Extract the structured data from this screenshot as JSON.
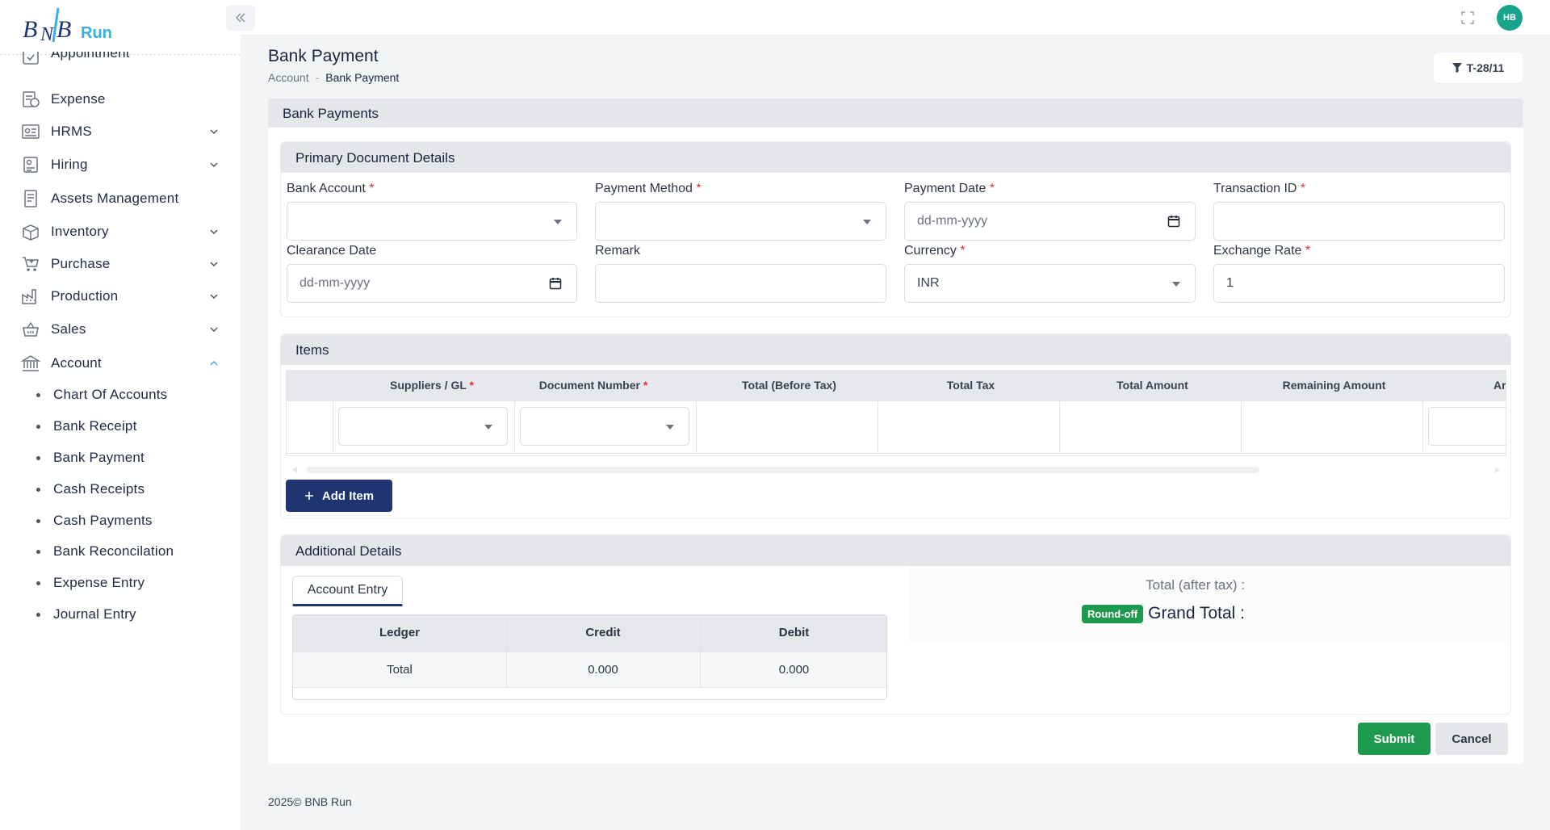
{
  "app": {
    "logo_text": "Run"
  },
  "topbar": {
    "avatar_initials": "HB"
  },
  "sidebar": {
    "items": [
      {
        "label": "Appointment",
        "has_chevron": false
      },
      {
        "label": "Expense",
        "has_chevron": false
      },
      {
        "label": "HRMS",
        "has_chevron": true
      },
      {
        "label": "Hiring",
        "has_chevron": true
      },
      {
        "label": "Assets Management",
        "has_chevron": false
      },
      {
        "label": "Inventory",
        "has_chevron": true
      },
      {
        "label": "Purchase",
        "has_chevron": true
      },
      {
        "label": "Production",
        "has_chevron": true
      },
      {
        "label": "Sales",
        "has_chevron": true
      },
      {
        "label": "Account",
        "has_chevron": true,
        "expanded": true
      }
    ],
    "account_subitems": [
      "Chart Of Accounts",
      "Bank Receipt",
      "Bank Payment",
      "Cash Receipts",
      "Cash Payments",
      "Bank Reconcilation",
      "Expense Entry",
      "Journal Entry"
    ]
  },
  "page": {
    "title": "Bank Payment",
    "breadcrumb": {
      "parent": "Account",
      "separator": "-",
      "current": "Bank Payment"
    },
    "filter_label": "T-28/11",
    "card_title": "Bank Payments"
  },
  "primary": {
    "title": "Primary Document Details",
    "fields": {
      "bank_account": {
        "label": "Bank Account",
        "required": "*",
        "value": ""
      },
      "payment_method": {
        "label": "Payment Method",
        "required": "*",
        "value": ""
      },
      "payment_date": {
        "label": "Payment Date",
        "required": "*",
        "placeholder": "dd-mm-yyyy"
      },
      "transaction_id": {
        "label": "Transaction ID",
        "required": "*",
        "value": ""
      },
      "clearance_date": {
        "label": "Clearance Date",
        "placeholder": "dd-mm-yyyy"
      },
      "remark": {
        "label": "Remark",
        "value": ""
      },
      "currency": {
        "label": "Currency",
        "required": "*",
        "value": "INR"
      },
      "exchange_rate": {
        "label": "Exchange Rate",
        "required": "*",
        "value": "1"
      }
    }
  },
  "items": {
    "title": "Items",
    "columns": {
      "suppliers": "Suppliers / GL",
      "document_number": "Document Number",
      "total_before_tax": "Total (Before Tax)",
      "total_tax": "Total Tax",
      "total_amount": "Total Amount",
      "remaining_amount": "Remaining Amount",
      "amount_partial": "Ar"
    },
    "required_mark": "*",
    "add_item_label": "Add Item"
  },
  "additional": {
    "title": "Additional Details",
    "tab_label": "Account Entry",
    "table": {
      "headers": [
        "Ledger",
        "Credit",
        "Debit"
      ],
      "total_row": [
        "Total",
        "0.000",
        "0.000"
      ]
    },
    "total_after_tax_label": "Total (after tax) :",
    "round_off_label": "Round-off",
    "grand_total_label": "Grand Total :"
  },
  "actions": {
    "submit": "Submit",
    "cancel": "Cancel"
  },
  "footer": {
    "text": "2025© BNB Run"
  },
  "colors": {
    "primary": "#1f3470",
    "success": "#1e9a4f",
    "avatar": "#18a48c",
    "accent": "#3aaee0"
  }
}
